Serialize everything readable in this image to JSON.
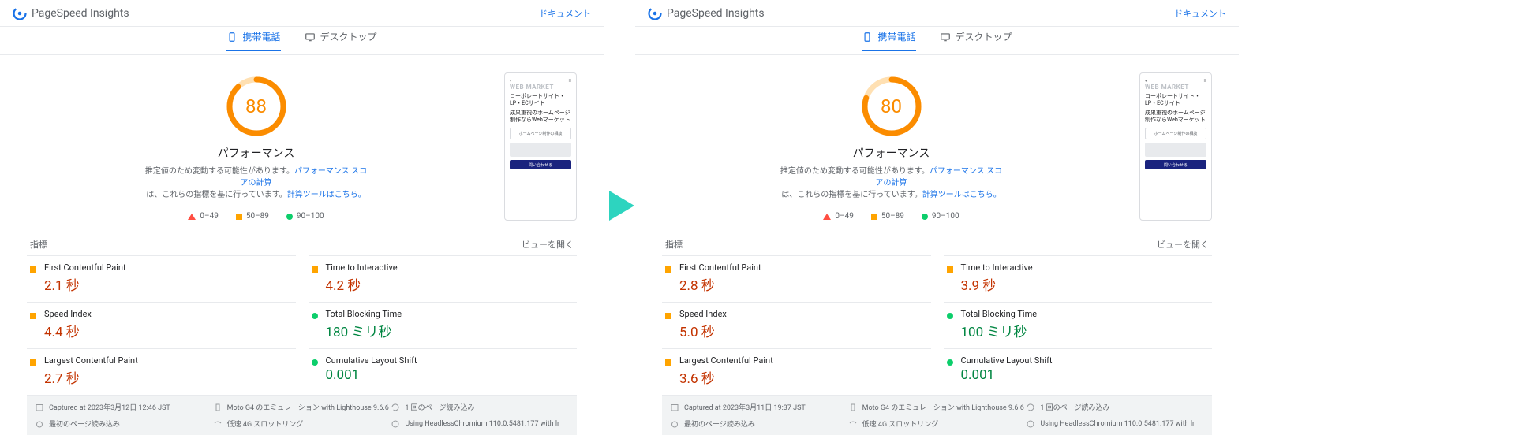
{
  "app": {
    "title": "PageSpeed Insights",
    "doc_link": "ドキュメント"
  },
  "tabs": {
    "mobile": "携帯電話",
    "desktop": "デスクトップ"
  },
  "legend": {
    "low": "0–49",
    "mid": "50–89",
    "high": "90–100"
  },
  "metrics_header": {
    "label": "指標",
    "expand": "ビューを開く"
  },
  "metric_names": {
    "fcp": "First Contentful Paint",
    "tti": "Time to Interactive",
    "si": "Speed Index",
    "tbt": "Total Blocking Time",
    "lcp": "Largest Contentful Paint",
    "cls": "Cumulative Layout Shift"
  },
  "perf": {
    "title": "パフォーマンス",
    "desc_1": "推定値のため変動する可能性があります。",
    "link_1": "パフォーマンス スコアの計算",
    "desc_2": "は、これらの指標を基に行っています。",
    "link_2": "計算ツールはこちら。"
  },
  "preview": {
    "brand": "WEB MARKET",
    "line1": "コーポレートサイト・LP・ECサイト",
    "line2": "成果重視のホームページ制作ならWebマーケット",
    "boxed": "ホームページ制作の相談",
    "bar": "問い合わせる"
  },
  "env_labels": {
    "emulation": "Moto G4 のエミュレーション with Lighthouse 9.6.6",
    "page_load": "1 回のページ読み込み",
    "first_load": "最初のページ読み込み",
    "throttle": "低速 4G スロットリング",
    "using": "Using HeadlessChromium 110.0.5481.177 with lr"
  },
  "panels": [
    {
      "key": "before",
      "score": "88",
      "score_color": "#fb8c00",
      "score_pct": 88,
      "metrics": {
        "fcp": {
          "value": "2.1 秒",
          "cls": "val-orange",
          "ind": "sq"
        },
        "tti": {
          "value": "4.2 秒",
          "cls": "val-orange",
          "ind": "sq"
        },
        "si": {
          "value": "4.4 秒",
          "cls": "val-orange",
          "ind": "sq"
        },
        "tbt": {
          "value": "180 ミリ秒",
          "cls": "val-green",
          "ind": "ci"
        },
        "lcp": {
          "value": "2.7 秒",
          "cls": "val-orange",
          "ind": "sq"
        },
        "cls": {
          "value": "0.001",
          "cls": "val-green",
          "ind": "ci"
        }
      },
      "captured": "Captured at 2023年3月12日 12:46 JST"
    },
    {
      "key": "after",
      "score": "80",
      "score_color": "#fb8c00",
      "score_pct": 80,
      "metrics": {
        "fcp": {
          "value": "2.8 秒",
          "cls": "val-orange",
          "ind": "sq"
        },
        "tti": {
          "value": "3.9 秒",
          "cls": "val-orange",
          "ind": "sq"
        },
        "si": {
          "value": "5.0 秒",
          "cls": "val-orange",
          "ind": "sq"
        },
        "tbt": {
          "value": "100 ミリ秒",
          "cls": "val-green",
          "ind": "ci"
        },
        "lcp": {
          "value": "3.6 秒",
          "cls": "val-orange",
          "ind": "sq"
        },
        "cls": {
          "value": "0.001",
          "cls": "val-green",
          "ind": "ci"
        }
      },
      "captured": "Captured at 2023年3月11日 19:37 JST"
    }
  ],
  "chart_data": [
    {
      "type": "pie",
      "title": "パフォーマンス",
      "categories": [
        "score",
        "remaining"
      ],
      "values": [
        88,
        12
      ],
      "ylim": [
        0,
        100
      ]
    },
    {
      "type": "pie",
      "title": "パフォーマンス",
      "categories": [
        "score",
        "remaining"
      ],
      "values": [
        80,
        20
      ],
      "ylim": [
        0,
        100
      ]
    }
  ]
}
